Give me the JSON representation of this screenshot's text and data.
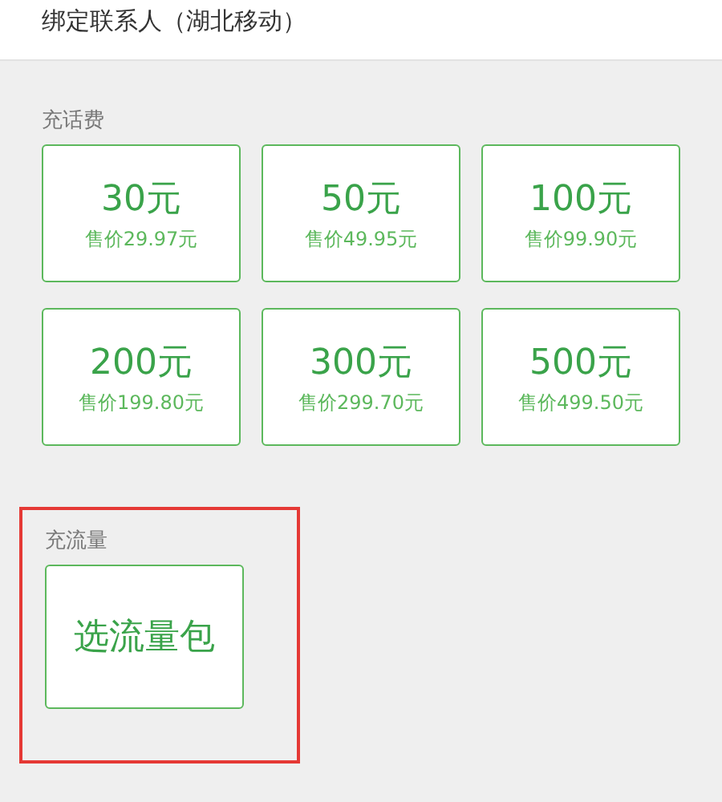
{
  "header": {
    "title": "绑定联系人（湖北移动）"
  },
  "sections": [
    {
      "kind": "grid",
      "title": "充话费",
      "highlighted": false,
      "items": [
        {
          "amount": "30元",
          "price": "售价29.97元"
        },
        {
          "amount": "50元",
          "price": "售价49.95元"
        },
        {
          "amount": "100元",
          "price": "售价99.90元"
        },
        {
          "amount": "200元",
          "price": "售价199.80元"
        },
        {
          "amount": "300元",
          "price": "售价299.70元"
        },
        {
          "amount": "500元",
          "price": "售价499.50元"
        }
      ]
    },
    {
      "kind": "single",
      "title": "充流量",
      "highlighted": true,
      "items": [
        {
          "amount": "选流量包"
        }
      ]
    }
  ]
}
